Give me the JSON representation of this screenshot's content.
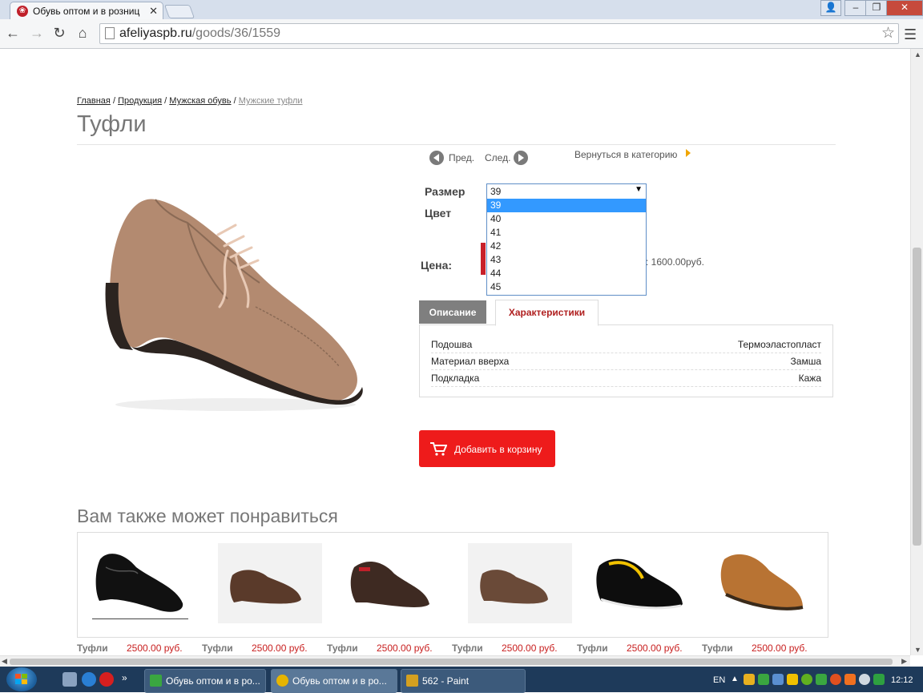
{
  "browser": {
    "tab_title": "Обувь оптом и в розниц",
    "url_host": "afeliyaspb.ru",
    "url_path": "/goods/36/1559"
  },
  "breadcrumb": {
    "items": [
      "Главная",
      "Продукция",
      "Мужская обувь"
    ],
    "current": "Мужские туфли",
    "separator": "/"
  },
  "product": {
    "title": "Туфли",
    "prev_label": "Пред.",
    "next_label": "След.",
    "back_label": "Вернуться в категорию",
    "size_label": "Размер",
    "color_label": "Цвет",
    "price_label": "Цена:",
    "selected_size": "39",
    "size_options": [
      "39",
      "40",
      "41",
      "42",
      "43",
      "44",
      "45"
    ],
    "price_extra": ": 1600.00руб.",
    "tabs": [
      "Описание",
      "Характеристики"
    ],
    "characteristics": [
      {
        "name": "Подошва",
        "value": "Термоэластопласт"
      },
      {
        "name": "Материал вверха",
        "value": "Замша"
      },
      {
        "name": "Подкладка",
        "value": "Кажа"
      }
    ],
    "cart_button": "Добавить в корзину"
  },
  "recommendations": {
    "title": "Вам также может понравиться",
    "items": [
      {
        "name": "Туфли",
        "price": "2500.00 руб."
      },
      {
        "name": "Туфли",
        "price": "2500.00 руб."
      },
      {
        "name": "Туфли",
        "price": "2500.00 руб."
      },
      {
        "name": "Туфли",
        "price": "2500.00 руб."
      },
      {
        "name": "Туфли",
        "price": "2500.00 руб."
      },
      {
        "name": "Туфли",
        "price": "2500.00 руб."
      }
    ]
  },
  "taskbar": {
    "tasks": [
      "Обувь оптом и в ро...",
      "Обувь оптом и в ро...",
      "562 - Paint"
    ],
    "lang": "EN",
    "clock": "12:12"
  },
  "colors": {
    "accent_red": "#ee1b1b",
    "tab_active_text": "#b02020",
    "price_red": "#c81e1e"
  }
}
